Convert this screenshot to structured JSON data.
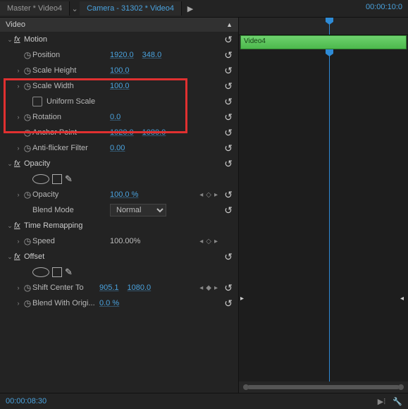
{
  "topbar": {
    "master_tab": "Master * Video4",
    "source_tab": "Camera - 31302 * Video4",
    "timecode": "00:00:10:0"
  },
  "section_header": "Video",
  "effects": {
    "motion": {
      "title": "Motion",
      "position": {
        "label": "Position",
        "x": "1920.0",
        "y": "348.0"
      },
      "scale_height": {
        "label": "Scale Height",
        "value": "100.0"
      },
      "scale_width": {
        "label": "Scale Width",
        "value": "100.0"
      },
      "uniform_scale": {
        "label": "Uniform Scale",
        "checked": false
      },
      "rotation": {
        "label": "Rotation",
        "value": "0.0"
      },
      "anchor": {
        "label": "Anchor Point",
        "x": "1920.0",
        "y": "1080.0"
      },
      "antiflicker": {
        "label": "Anti-flicker Filter",
        "value": "0.00"
      }
    },
    "opacity": {
      "title": "Opacity",
      "opacity": {
        "label": "Opacity",
        "value": "100.0 %"
      },
      "blend": {
        "label": "Blend Mode",
        "value": "Normal"
      }
    },
    "time_remap": {
      "title": "Time Remapping",
      "speed": {
        "label": "Speed",
        "value": "100.00%"
      }
    },
    "offset": {
      "title": "Offset",
      "shift": {
        "label": "Shift Center To",
        "x": "905.1",
        "y": "1080.0"
      },
      "blend": {
        "label": "Blend With Origi...",
        "value": "0.0 %"
      }
    }
  },
  "timeline": {
    "clip_name": "Video4"
  },
  "footer": {
    "timecode": "00:00:08:30"
  }
}
